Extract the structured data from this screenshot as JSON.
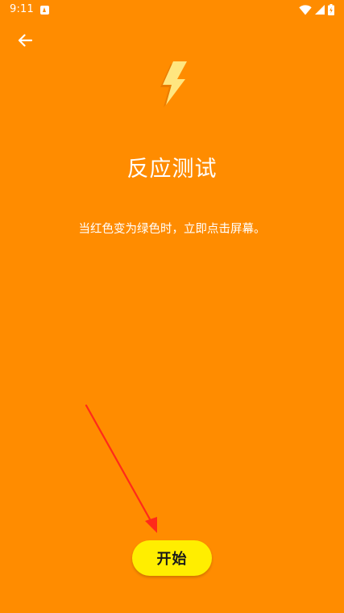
{
  "status_bar": {
    "time": "9:11",
    "icons": [
      "notification-icon",
      "wifi-icon",
      "signal-icon",
      "battery-icon"
    ]
  },
  "header": {
    "back_icon": "arrow-left-icon"
  },
  "hero": {
    "icon": "lightning-bolt-icon",
    "title": "反应测试",
    "instructions": "当红色变为绿色时，立即点击屏幕。"
  },
  "actions": {
    "start_label": "开始"
  },
  "colors": {
    "background": "#ff8c00",
    "button": "#ffee00",
    "bolt": "#ffe680",
    "annotation": "#ff2a1a"
  }
}
